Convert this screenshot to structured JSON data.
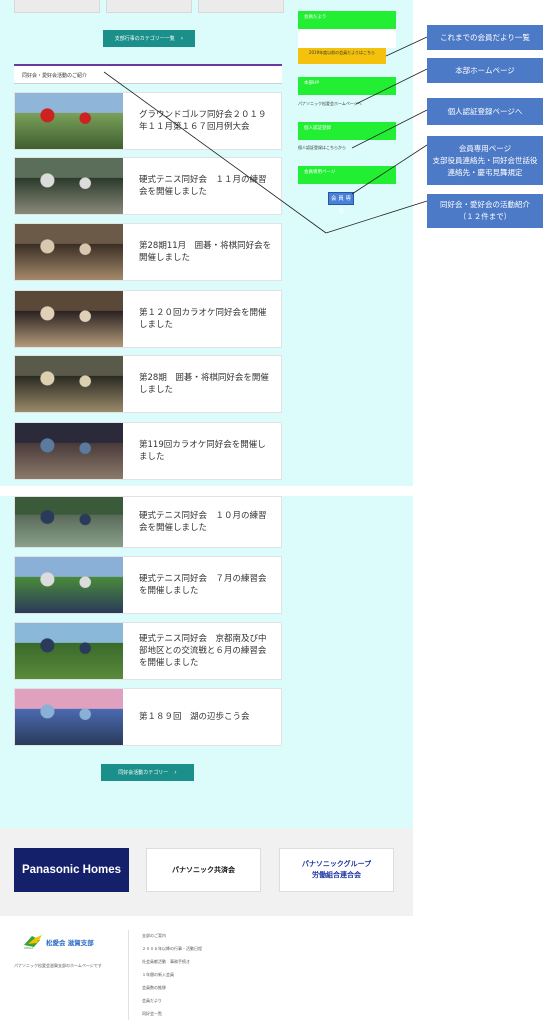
{
  "main": {
    "category_btn_top": "支部行事のカテゴリー一覧",
    "section_title": "同好会・愛好会活動のご紹介",
    "category_btn_bottom": "同好会活動カテゴリー",
    "cards": [
      {
        "title": "グラウンドゴルフ同好会２０１９年１１月第１６７回月例大会"
      },
      {
        "title": "硬式テニス同好会　１１月の練習会を開催しました"
      },
      {
        "title": "第28期11月　囲碁・将棋同好会を開催しました"
      },
      {
        "title": "第１２０回カラオケ同好会を開催しました"
      },
      {
        "title": "第28期　囲碁・将棋同好会を開催しました"
      },
      {
        "title": "第119回カラオケ同好会を開催しました"
      },
      {
        "title": "硬式テニス同好会　１０月の練習会を開催しました"
      },
      {
        "title": "硬式テニス同好会　７月の練習会を開催しました"
      },
      {
        "title": "硬式テニス同好会　京都南及び中部地区との交流戦と６月の練習会を開催しました"
      },
      {
        "title": "第１８９回　湖の辺歩こう会"
      }
    ]
  },
  "sidebar": {
    "kaiin_dayori": "会員だより",
    "kaiin_dayori_archive": "2019年度以前の会員だよりはこちら",
    "honbu_hp": "本部HP",
    "honbu_hp_text": "パナソニック松愛会ホームページへ",
    "auth_register": "個人認証登録",
    "auth_register_text": "個人認証登録はこちらから",
    "members_page": "会員専用ページ",
    "members_button": "会 員 専 用"
  },
  "annotations": [
    {
      "text": "これまでの会員だより一覧"
    },
    {
      "text": "本部ホームページ"
    },
    {
      "text": "個人認証登録ページへ"
    },
    {
      "text": "会員専用ページ\n支部役員連絡先・同好会世話役連絡先・慶弔見舞規定"
    },
    {
      "text": "同好会・愛好会の活動紹介\n（１２件まで）"
    }
  ],
  "partners": {
    "panasonic_homes": "Panasonic Homes",
    "kyosaikai": "パナソニック共済会",
    "union_line1": "パナソニックグループ",
    "union_line2": "労働組合連合会"
  },
  "footer": {
    "logo_text": "松愛会 滋賀支部",
    "description": "パナソニック松愛会滋賀支部のホームページです",
    "links": [
      "支部のご案内",
      "２００６年以降の行事・活動日程",
      "社会貢献活動　事務手続き",
      "１年間の新入会員",
      "会員数の推移",
      "会員だより",
      "同好会一覧"
    ]
  },
  "colors": {
    "main_bg": "#dcfcfc",
    "teal_button": "#1b8f8a",
    "green_button": "#22ee33",
    "callout_blue": "#4d7ac6",
    "section_accent": "#6a3aa0"
  }
}
